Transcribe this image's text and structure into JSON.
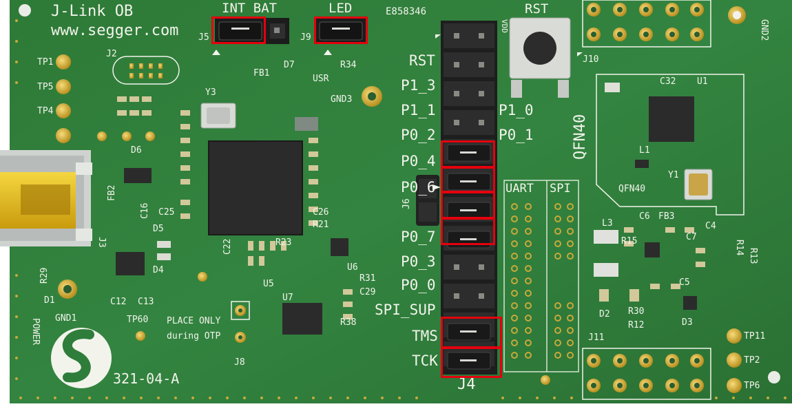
{
  "board": {
    "name": "J-Link OB",
    "url": "www.segger.com",
    "revision": "321-04-A",
    "part_code": "E858346"
  },
  "jumpers": {
    "int_bat": "INT BAT",
    "led": "LED",
    "rst_button": "RST"
  },
  "header_j4": {
    "name": "J4",
    "pins": [
      "RST",
      "P1_3",
      "P1_1",
      "P0_2",
      "P0_4",
      "P0_6",
      "P0_7",
      "P0_3",
      "P0_0",
      "SPI_SUP",
      "TMS",
      "TCK"
    ],
    "right_labels": [
      "P1_0",
      "P0_1"
    ],
    "vdd": "VDD"
  },
  "labels": {
    "uart": "UART",
    "spi": "SPI",
    "qfn40": "QFN40",
    "qfn40_small": "QFN40",
    "gnd1": "GND1",
    "gnd2": "GND2",
    "gnd3": "GND3",
    "power": "POWER",
    "usr": "USR",
    "tp60": "TP60",
    "otp_line1": "PLACE ONLY",
    "otp_line2": "during OTP",
    "j2": "J2",
    "j3": "J3",
    "j5": "J5",
    "j6": "J6",
    "j8": "J8",
    "j9": "J9",
    "j10": "J10",
    "j11": "J11",
    "y1": "Y1",
    "y3": "Y3",
    "u1": "U1",
    "u5": "U5",
    "u6": "U6",
    "u7": "U7",
    "d1": "D1",
    "d2": "D2",
    "d3": "D3",
    "d4": "D4",
    "d5": "D5",
    "d6": "D6",
    "d7": "D7",
    "fb1": "FB1",
    "fb2": "FB2",
    "fb3": "FB3",
    "l1": "L1",
    "l3": "L3",
    "r34": "R34",
    "r31": "R31",
    "r38": "R38",
    "r30": "R30",
    "r12": "R12",
    "r13": "R13",
    "r14": "R14",
    "r15": "R15",
    "r21": "R21",
    "r23": "R23",
    "r29": "R29",
    "c12": "C12",
    "c13": "C13",
    "c16": "C16",
    "c22": "C22",
    "c25": "C25",
    "c26": "C26",
    "c29": "C29",
    "c32": "C32",
    "c4": "C4",
    "c5": "C5",
    "c6": "C6",
    "c7": "C7",
    "tp1": "TP1",
    "tp2": "TP2",
    "tp4": "TP4",
    "tp5": "TP5",
    "tp6": "TP6",
    "tp11": "TP11"
  },
  "colors": {
    "pcb": "#2f7d3a",
    "pcb_dark": "#1f5a2a",
    "silk": "#f2f4ec",
    "gold": "#d8b33a",
    "highlight": "#e5000d",
    "usb": "#e8c21a"
  }
}
